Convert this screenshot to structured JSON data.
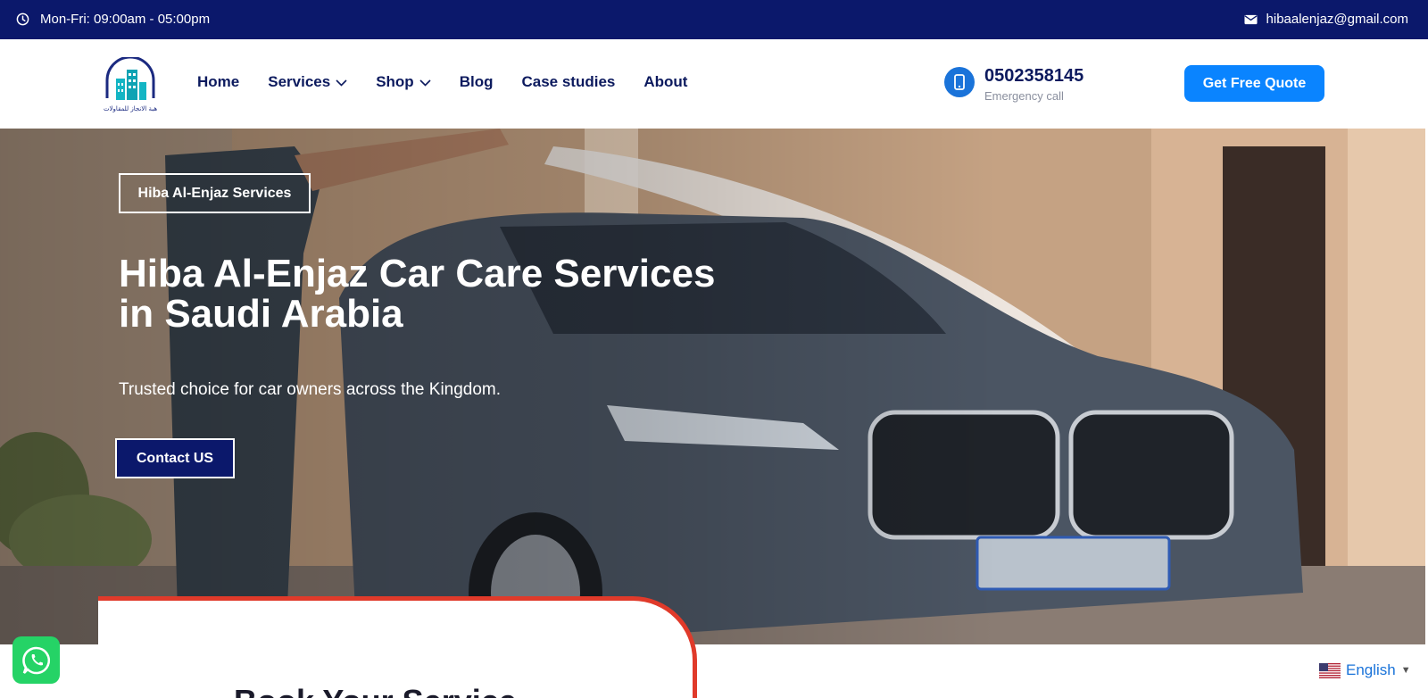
{
  "topbar": {
    "hours": "Mon-Fri: 09:00am - 05:00pm",
    "email": "hibaalenjaz@gmail.com"
  },
  "header": {
    "logo_caption": "هبة الانجاز للمقاولات",
    "nav": {
      "home": "Home",
      "services": "Services",
      "shop": "Shop",
      "blog": "Blog",
      "case_studies": "Case studies",
      "about": "About"
    },
    "phone": {
      "number": "0502358145",
      "label": "Emergency call"
    },
    "quote_button": "Get Free Quote"
  },
  "hero": {
    "badge": "Hiba Al-Enjaz Services",
    "title_line1": "Hiba Al-Enjaz Car Care Services",
    "title_line2": "in Saudi Arabia",
    "tagline": "Trusted choice for car owners across the Kingdom.",
    "contact_button": "Contact US"
  },
  "card": {
    "peek_text": "Book Your Service"
  },
  "language": {
    "label": "English"
  },
  "colors": {
    "topbar": "#0b186b",
    "accent": "#0a84ff",
    "card_border": "#e03a2a",
    "whatsapp": "#25d366"
  },
  "icons": [
    "clock-icon",
    "mail-icon",
    "logo-icon",
    "chevron-down-icon",
    "phone-icon",
    "whatsapp-icon",
    "us-flag-icon"
  ]
}
